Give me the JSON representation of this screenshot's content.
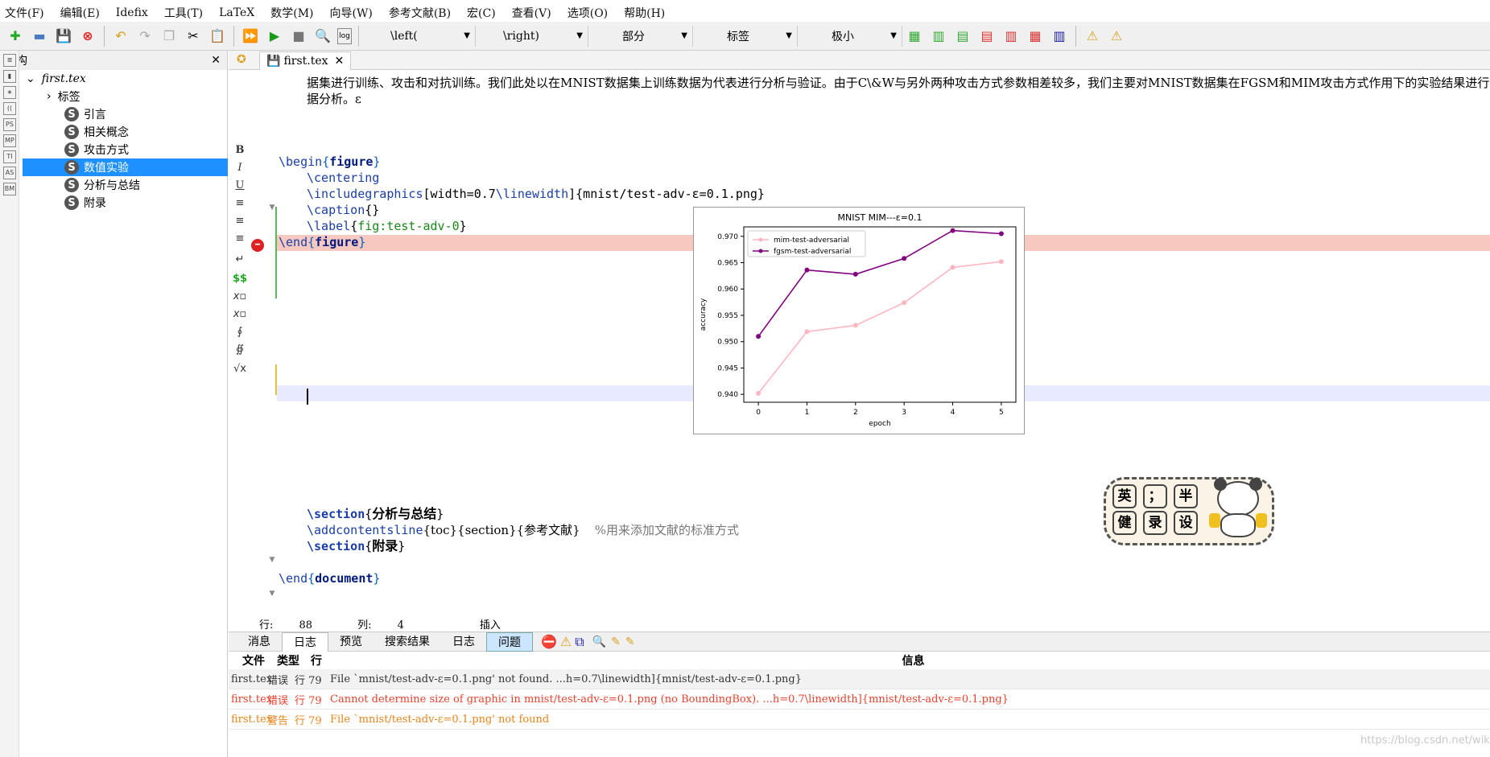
{
  "menu": [
    "文件(F)",
    "编辑(E)",
    "Idefix",
    "工具(T)",
    "LaTeX",
    "数学(M)",
    "向导(W)",
    "参考文献(B)",
    "宏(C)",
    "查看(V)",
    "选项(O)",
    "帮助(H)"
  ],
  "toolbar": {
    "combo_left": "\\left(",
    "combo_right": "\\right)",
    "combo_part": "部分",
    "combo_label": "标签",
    "combo_size": "极小"
  },
  "structure": {
    "title": "结构",
    "file": "first.tex",
    "items": [
      "标签",
      "引言",
      "相关概念",
      "攻击方式",
      "数值实验",
      "分析与总结",
      "附录"
    ]
  },
  "editor": {
    "tab": "first.tex",
    "lines": {
      "l1": "据集进行训练、攻击和对抗训练。我们此处以在MNIST数据集上训练数据为代表进行分析与验证。由于C\\&W与另外两种攻击方式参数相差较多，我们主要对MNIST数据集在FGSM和MIM攻击方式作用下的实验结果进行数",
      "l2": "据分析。ε",
      "begin": "\\begin",
      "figure": "figure",
      "centering": "\\centering",
      "includegraphics": "\\includegraphics",
      "opt": "[width=0.7",
      "linewidth": "\\linewidth",
      "path": "]{mnist/test-adv-ε=0.1.png}",
      "caption": "\\caption",
      "caption_arg": "{}",
      "label": "\\label",
      "label_arg": "fig:test-adv-0",
      "end": "\\end",
      "section": "\\section",
      "sec1": "分析与总结",
      "addcontents": "\\addcontentsline",
      "toc": "{toc}{section}{参考文献}",
      "comment": "%用来添加文献的标准方式",
      "sec2": "附录",
      "document": "document"
    }
  },
  "status": {
    "line_label": "行:",
    "line": "88",
    "col_label": "列:",
    "col": "4",
    "mode": "插入"
  },
  "bottom": {
    "tabs": [
      "消息",
      "日志",
      "预览",
      "搜索结果",
      "日志",
      "问题"
    ],
    "headers": {
      "file": "文件",
      "type": "类型",
      "line": "行",
      "info": "信息"
    },
    "rows": [
      {
        "file": "first.tex",
        "type": "错误",
        "line": "行 79",
        "info": "File `mnist/test-adv-ε=0.1.png' not found. ...h=0.7\\linewidth]{mnist/test-adv-ε=0.1.png}",
        "color": "#333333"
      },
      {
        "file": "first.tex",
        "type": "错误",
        "line": "行 79",
        "info": "Cannot determine size of graphic in mnist/test-adv-ε=0.1.png (no BoundingBox). ...h=0.7\\linewidth]{mnist/test-adv-ε=0.1.png}",
        "color": "#e8412c"
      },
      {
        "file": "first.tex",
        "type": "警告",
        "line": "行 79",
        "info": "File `mnist/test-adv-ε=0.1.png' not found",
        "color": "#e8841c"
      }
    ]
  },
  "stamp": {
    "chars": [
      "英",
      "；",
      "半",
      "健",
      "录",
      "设"
    ]
  },
  "watermark": "https://blog.csdn.net/wiki_Li",
  "chart_data": {
    "type": "line",
    "title": "MNIST MIM---ε=0.1",
    "xlabel": "epoch",
    "ylabel": "accuracy",
    "x": [
      0,
      1,
      2,
      3,
      4,
      5
    ],
    "xlim": [
      -0.3,
      5.3
    ],
    "ylim": [
      0.9385,
      0.9718
    ],
    "yticks": [
      "0.940",
      "0.945",
      "0.950",
      "0.955",
      "0.960",
      "0.965",
      "0.970"
    ],
    "xticks": [
      "0",
      "1",
      "2",
      "3",
      "4",
      "5"
    ],
    "legend": "top-left",
    "series": [
      {
        "name": "mim-test-adversarial",
        "color": "#ffb6c1",
        "values": [
          0.9402,
          0.9519,
          0.9531,
          0.9574,
          0.9641,
          0.9652
        ]
      },
      {
        "name": "fgsm-test-adversarial",
        "color": "#800080",
        "values": [
          0.951,
          0.9636,
          0.9628,
          0.9658,
          0.9711,
          0.9705
        ]
      }
    ]
  }
}
